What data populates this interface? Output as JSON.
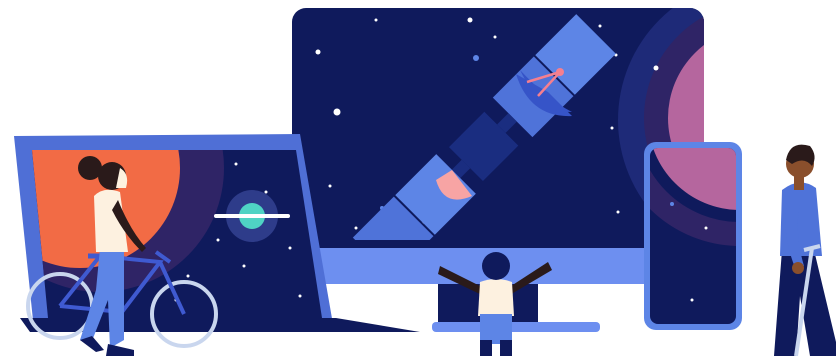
{
  "colors": {
    "background": "#ffffff",
    "screen_night": "#0f1a5c",
    "device_frame": "#4f6fd6",
    "device_frame_light": "#6d8ff0",
    "satellite_panel": "#5d85e6",
    "satellite_body": "#1a2d80",
    "satellite_dish": "#3654c8",
    "satellite_cap": "#f7a4a4",
    "antenna": "#f57f8f",
    "sun_orange": "#f26b45",
    "planet_magenta": "#b5669e",
    "planet_ring_dark": "#2f2466",
    "ringed_planet": "#4fd3c4",
    "skin_dark": "#2a1a1a",
    "skin_brown": "#8a4f2c",
    "shirt_cream": "#fdf1e0",
    "pants_blue": "#4f73d9",
    "jacket_blue": "#4f73d9",
    "bike_frame": "#3f5ad1",
    "crutch_silver": "#c9d6ee"
  },
  "scene": {
    "devices": [
      "laptop",
      "desktop-monitor",
      "smartphone"
    ],
    "figures": [
      "cyclist",
      "child-with-raised-arms",
      "person-with-crutch"
    ],
    "space_objects": [
      "satellite",
      "ringed-planet",
      "orange-sun",
      "magenta-planet",
      "stars"
    ]
  }
}
